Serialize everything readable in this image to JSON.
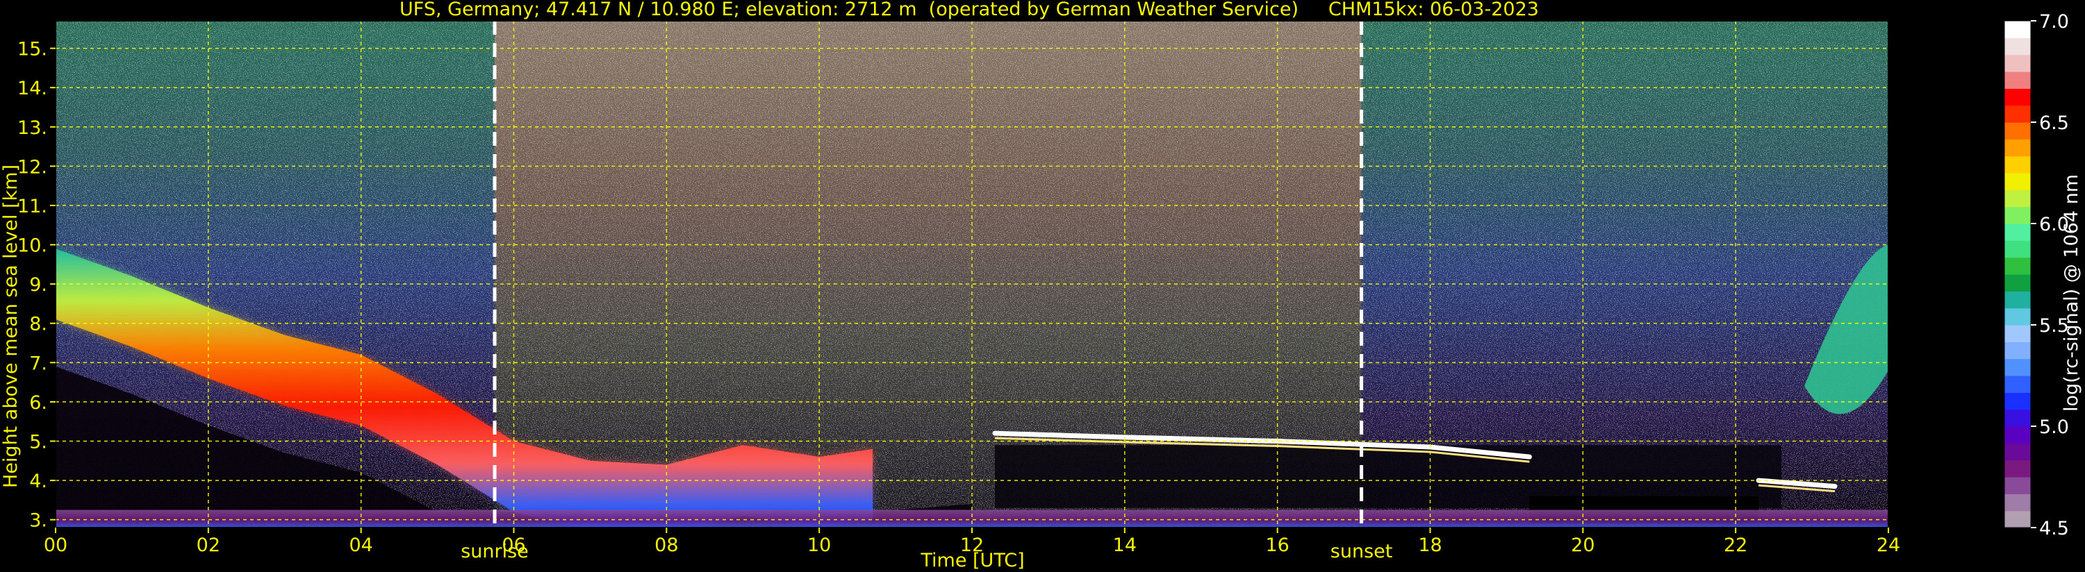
{
  "chart_data": {
    "type": "heatmap",
    "title": "UFS, Germany; 47.417 N / 10.980 E; elevation: 2712 m  (operated by German Weather Service)     CHM15kx: 06-03-2023",
    "xlabel": "Time [UTC]",
    "ylabel": "Height above mean sea level [km]",
    "xlim": [
      0,
      24
    ],
    "ylim": [
      2.8,
      15.7
    ],
    "x_ticks": [
      0,
      2,
      4,
      6,
      8,
      10,
      12,
      14,
      16,
      18,
      20,
      22,
      24
    ],
    "x_tick_labels": [
      "00",
      "02",
      "04",
      "06",
      "08",
      "10",
      "12",
      "14",
      "16",
      "18",
      "20",
      "22",
      "24"
    ],
    "y_ticks": [
      3,
      4,
      5,
      6,
      7,
      8,
      9,
      10,
      11,
      12,
      13,
      14,
      15
    ],
    "y_tick_labels": [
      "3.",
      "4.",
      "5.",
      "6.",
      "7.",
      "8.",
      "9.",
      "10.",
      "11.",
      "12.",
      "13.",
      "14.",
      "15."
    ],
    "grid": true,
    "grid_color": "#ffff00",
    "events": [
      {
        "label": "sunrise",
        "time": 5.75
      },
      {
        "label": "sunset",
        "time": 17.1
      }
    ],
    "colorbar": {
      "label": "log(rc-signal) @ 1064 nm",
      "range": [
        4.5,
        7.0
      ],
      "ticks": [
        4.5,
        5.0,
        5.5,
        6.0,
        6.5,
        7.0
      ],
      "tick_labels": [
        "4.5",
        "5.0",
        "5.5",
        "6.0",
        "6.5",
        "7.0"
      ],
      "colors": [
        "#b0a0b0",
        "#a07ca8",
        "#8a4a9a",
        "#7a1a80",
        "#6a0a9a",
        "#5a00c0",
        "#3a10e0",
        "#1a30ff",
        "#3060ff",
        "#5090ff",
        "#80b0ff",
        "#a0c8ff",
        "#60c8e0",
        "#20b0a0",
        "#10a040",
        "#30c040",
        "#40e080",
        "#50f0a0",
        "#80f060",
        "#c0f040",
        "#f0f000",
        "#ffd000",
        "#ffa000",
        "#ff7000",
        "#ff3000",
        "#ff0000",
        "#f08080",
        "#f0c0c0",
        "#f0e0e0",
        "#ffffff"
      ]
    },
    "features": [
      {
        "name": "aerosol layer top",
        "points": [
          [
            0,
            9.9
          ],
          [
            1,
            9.2
          ],
          [
            2,
            8.4
          ],
          [
            3,
            7.7
          ],
          [
            4,
            7.2
          ],
          [
            5,
            6.2
          ],
          [
            6,
            5.0
          ],
          [
            7,
            4.5
          ],
          [
            8,
            4.4
          ],
          [
            9,
            4.9
          ],
          [
            10,
            4.6
          ],
          [
            10.7,
            4.8
          ]
        ]
      },
      {
        "name": "cloud layer",
        "points": [
          [
            12.3,
            5.2
          ],
          [
            14,
            5.1
          ],
          [
            16,
            5.0
          ],
          [
            18,
            4.85
          ],
          [
            19.3,
            4.6
          ]
        ]
      },
      {
        "name": "cloud layer late",
        "points": [
          [
            22.3,
            4.0
          ],
          [
            23.3,
            3.85
          ]
        ]
      }
    ]
  }
}
